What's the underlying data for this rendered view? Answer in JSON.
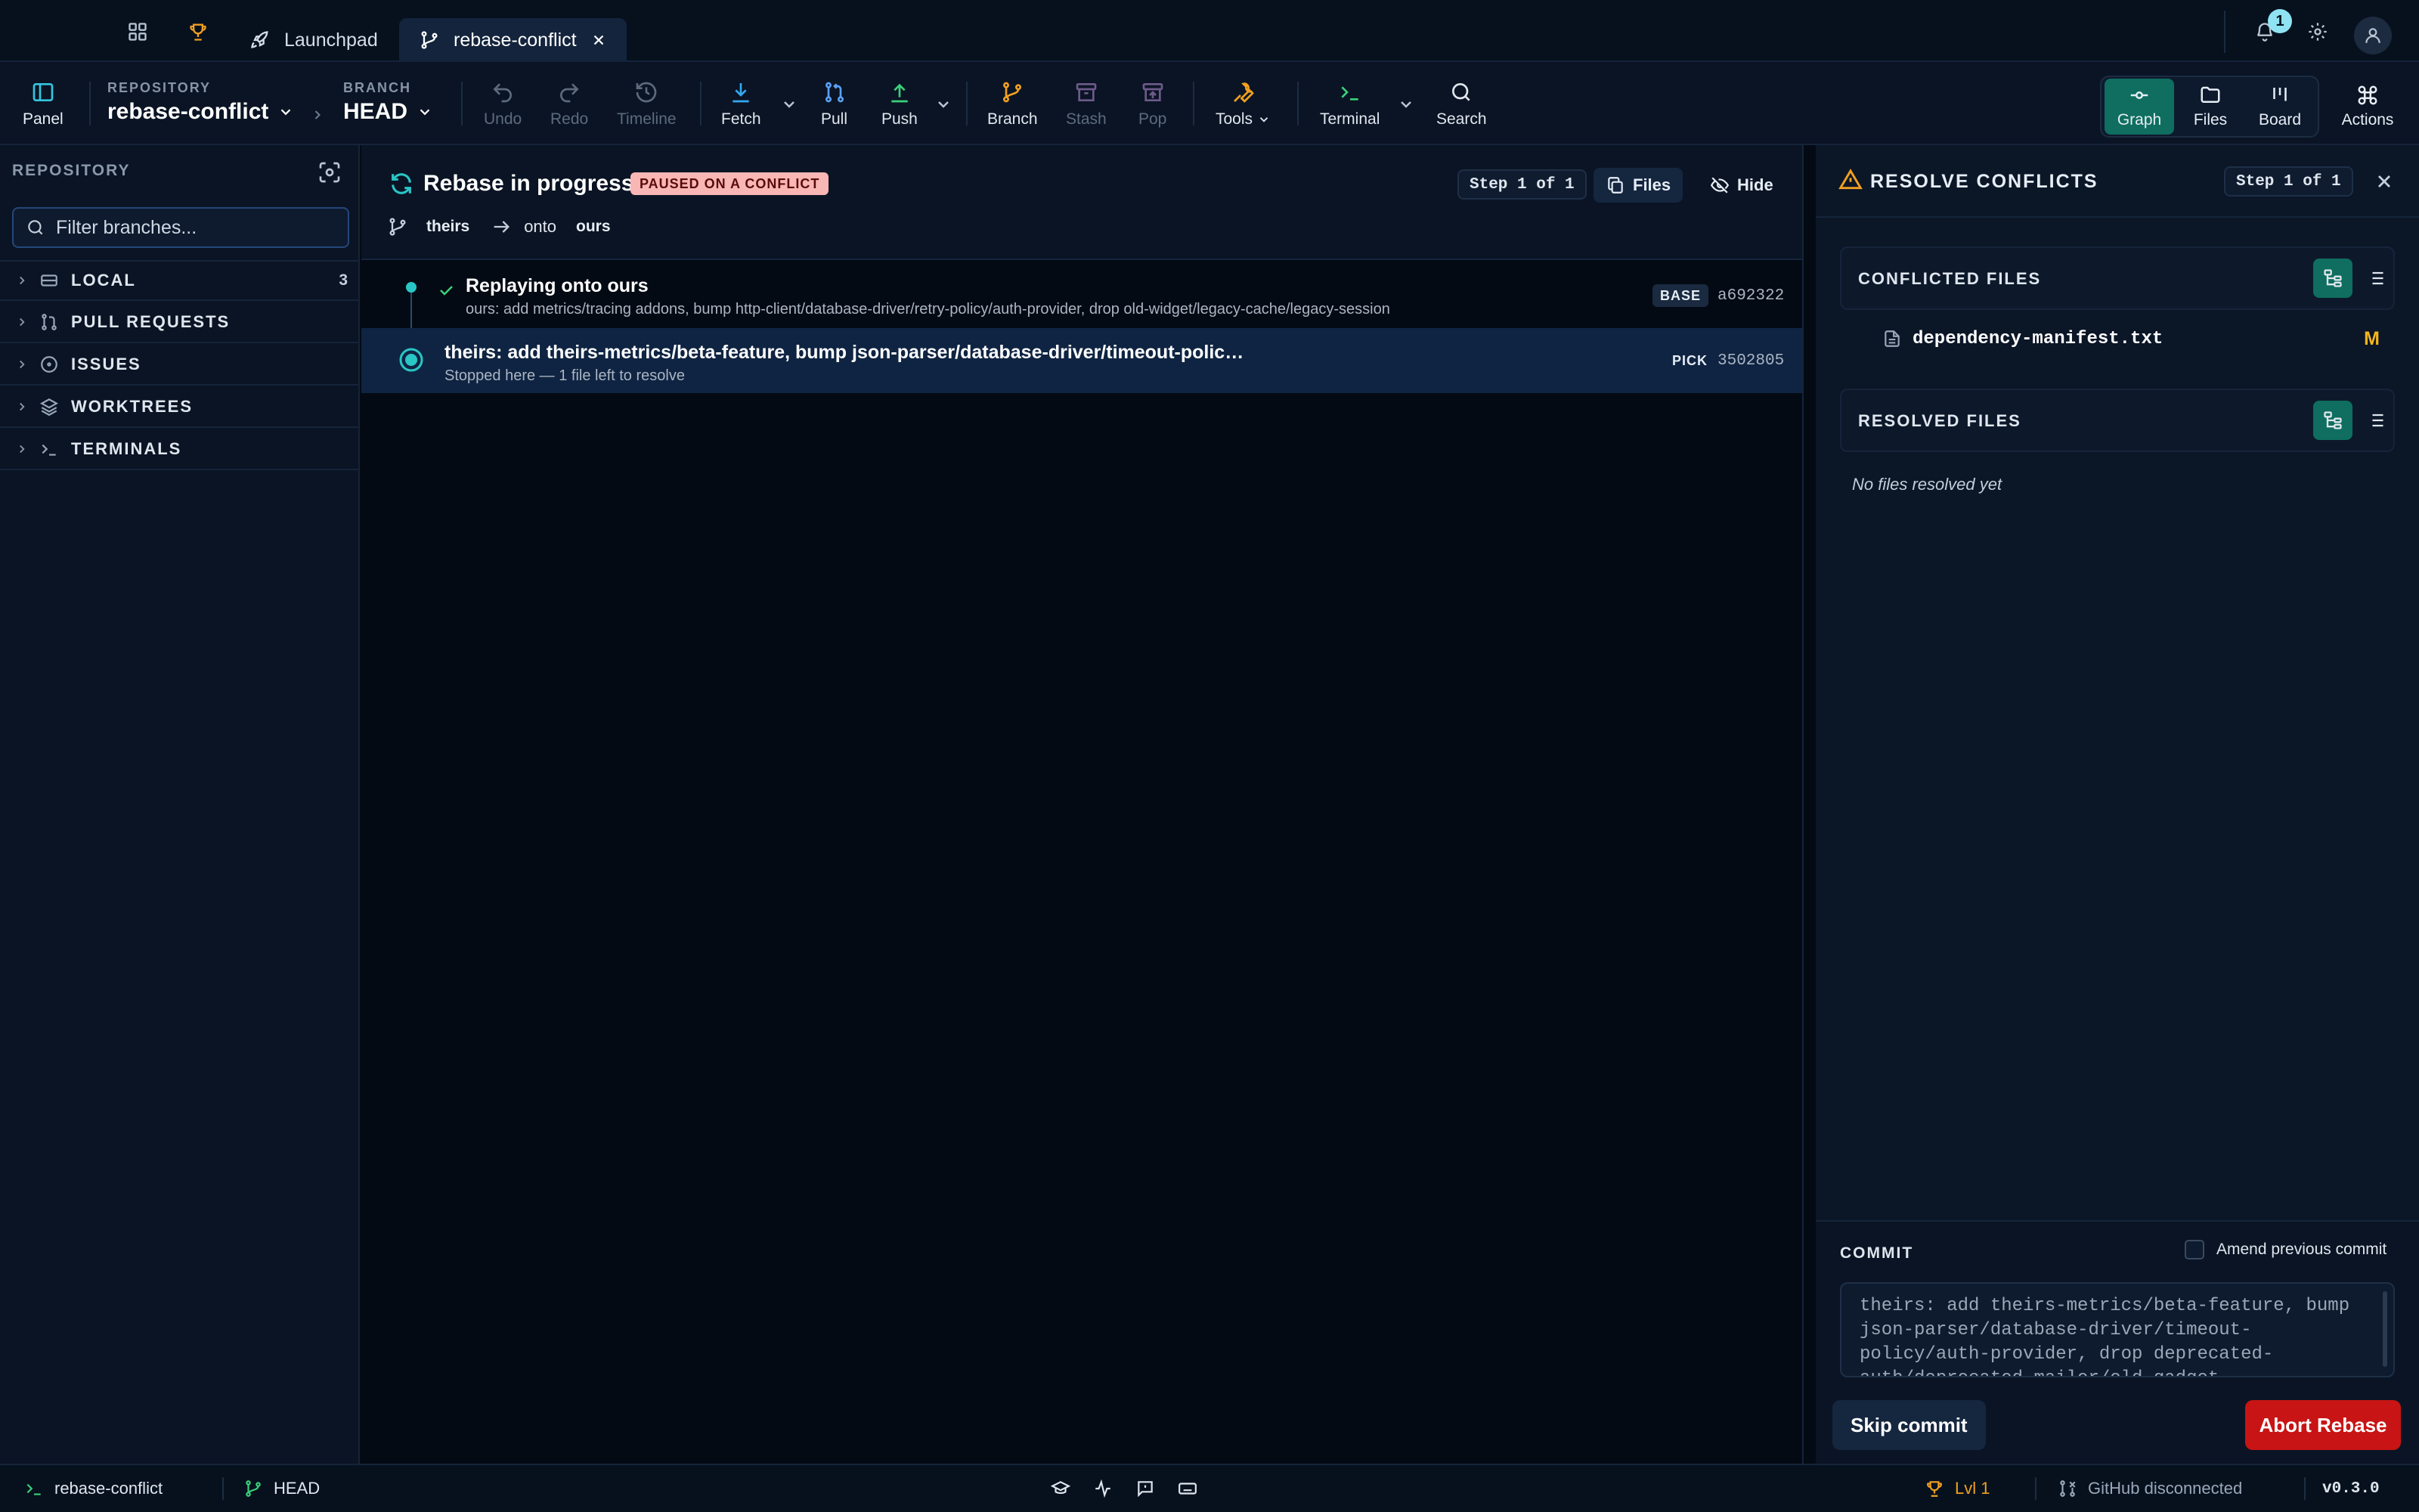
{
  "titlebar": {
    "tabs": [
      {
        "label": "Launchpad",
        "icon": "rocket-icon",
        "active": false
      },
      {
        "label": "rebase-conflict",
        "icon": "git-branch-icon",
        "active": true
      }
    ],
    "notification_count": "1"
  },
  "toolbar": {
    "panel_label": "Panel",
    "repository_caption": "REPOSITORY",
    "repository_name": "rebase-conflict",
    "branch_caption": "BRANCH",
    "branch_name": "HEAD",
    "undo": "Undo",
    "redo": "Redo",
    "timeline": "Timeline",
    "fetch": "Fetch",
    "pull": "Pull",
    "push": "Push",
    "branch": "Branch",
    "stash": "Stash",
    "pop": "Pop",
    "tools": "Tools",
    "terminal": "Terminal",
    "search": "Search",
    "views": {
      "graph": "Graph",
      "files": "Files",
      "board": "Board"
    },
    "actions": "Actions"
  },
  "sidebar": {
    "heading": "REPOSITORY",
    "filter_placeholder": "Filter branches...",
    "sections": [
      {
        "label": "LOCAL",
        "count": "3"
      },
      {
        "label": "PULL REQUESTS"
      },
      {
        "label": "ISSUES"
      },
      {
        "label": "WORKTREES"
      },
      {
        "label": "TERMINALS"
      }
    ]
  },
  "rebase": {
    "title": "Rebase in progress",
    "status_badge": "PAUSED ON A CONFLICT",
    "from_branch": "theirs",
    "onto_word": "onto",
    "onto_branch": "ours",
    "step": "Step 1 of 1",
    "files_button": "Files",
    "hide_button": "Hide",
    "commits": [
      {
        "title": "Replaying onto ours",
        "subtitle": "ours: add metrics/tracing addons, bump http-client/database-driver/retry-policy/auth-provider, drop old-widget/legacy-cache/legacy-session",
        "tag": "BASE",
        "sha": "a692322"
      },
      {
        "title": "theirs: add theirs-metrics/beta-feature, bump json-parser/database-driver/timeout-policy/auth-provider, drop deprecated-auth/deprecated-mailer/old-gadget",
        "subtitle": "Stopped here — 1 file left to resolve",
        "tag": "PICK",
        "sha": "3502805"
      }
    ]
  },
  "resolve": {
    "title": "RESOLVE CONFLICTS",
    "step": "Step 1 of 1",
    "conflicted_caption": "CONFLICTED FILES",
    "conflicted_files": [
      {
        "name": "dependency-manifest.txt",
        "status": "M"
      }
    ],
    "resolved_caption": "RESOLVED FILES",
    "resolved_empty": "No files resolved yet",
    "commit_caption": "COMMIT",
    "amend_label": "Amend previous commit",
    "commit_message": "theirs: add theirs-metrics/beta-feature, bump json-parser/database-driver/timeout-policy/auth-provider, drop deprecated-auth/deprecated-mailer/old-gadget",
    "skip_button": "Skip commit",
    "abort_button": "Abort Rebase"
  },
  "statusbar": {
    "repo": "rebase-conflict",
    "branch": "HEAD",
    "level": "Lvl 1",
    "github": "GitHub disconnected",
    "version": "v0.3.0"
  },
  "colors": {
    "accent_teal": "#0f6e5f",
    "conflict_badge": "#f8b7b4",
    "abort_red": "#c81414",
    "modified_yellow": "#f2b51c",
    "warning_orange": "#f0a020"
  }
}
